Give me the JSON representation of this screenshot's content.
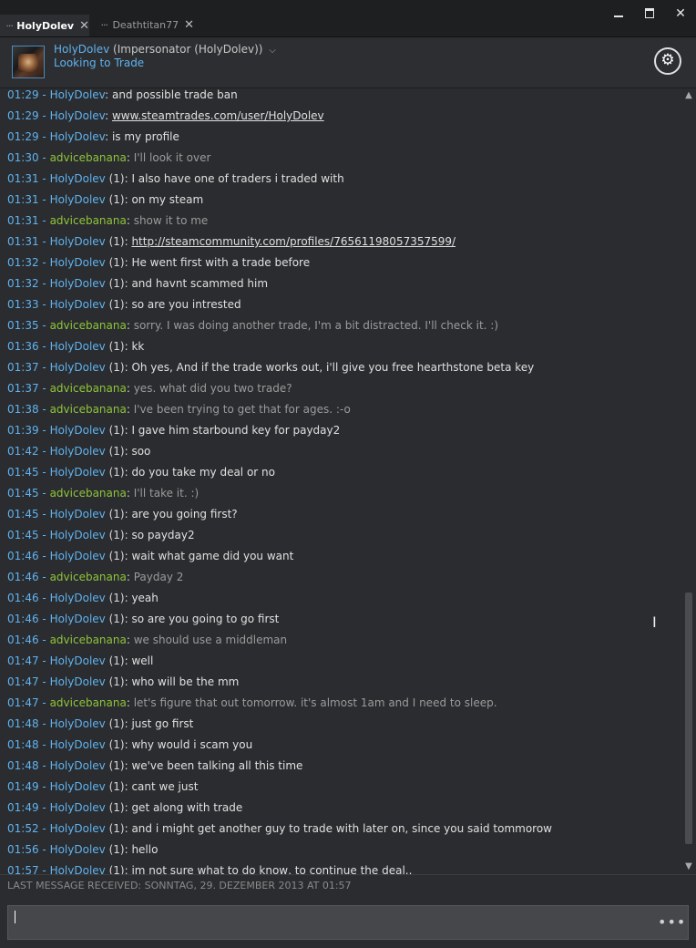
{
  "tabs": [
    {
      "label": "HolyDolev",
      "active": true
    },
    {
      "label": "Deathtitan77",
      "active": false
    }
  ],
  "window": {
    "minimize_icon": "minimize-icon",
    "maximize_icon": "maximize-icon",
    "close_icon": "close-icon"
  },
  "friend": {
    "name": "HolyDolev",
    "persona": "(Impersonator (HolyDolev))",
    "status": "Looking to Trade"
  },
  "messages": [
    {
      "ts": "01:29",
      "name": "HolyDolev",
      "tag": "",
      "text": "and possible trade ban",
      "who": "them",
      "link": false
    },
    {
      "ts": "01:29",
      "name": "HolyDolev",
      "tag": "",
      "text": "www.steamtrades.com/user/HolyDolev",
      "who": "them",
      "link": true
    },
    {
      "ts": "01:29",
      "name": "HolyDolev",
      "tag": "",
      "text": "is my profile",
      "who": "them",
      "link": false
    },
    {
      "ts": "01:30",
      "name": "advicebanana",
      "tag": "",
      "text": "I'll look it over",
      "who": "me",
      "link": false
    },
    {
      "ts": "01:31",
      "name": "HolyDolev",
      "tag": " (1)",
      "text": "I also have one of traders i traded with",
      "who": "them",
      "link": false
    },
    {
      "ts": "01:31",
      "name": "HolyDolev",
      "tag": " (1)",
      "text": "on my steam",
      "who": "them",
      "link": false
    },
    {
      "ts": "01:31",
      "name": "advicebanana",
      "tag": "",
      "text": "show it to me",
      "who": "me",
      "link": false
    },
    {
      "ts": "01:31",
      "name": "HolyDolev",
      "tag": " (1)",
      "text": "http://steamcommunity.com/profiles/76561198057357599/",
      "who": "them",
      "link": true
    },
    {
      "ts": "01:32",
      "name": "HolyDolev",
      "tag": " (1)",
      "text": "He went first with a trade before",
      "who": "them",
      "link": false
    },
    {
      "ts": "01:32",
      "name": "HolyDolev",
      "tag": " (1)",
      "text": "and havnt scammed him",
      "who": "them",
      "link": false
    },
    {
      "ts": "01:33",
      "name": "HolyDolev",
      "tag": " (1)",
      "text": "so are you intrested",
      "who": "them",
      "link": false
    },
    {
      "ts": "01:35",
      "name": "advicebanana",
      "tag": "",
      "text": "sorry. I was doing another trade, I'm a bit distracted. I'll check it. :)",
      "who": "me",
      "link": false
    },
    {
      "ts": "01:36",
      "name": "HolyDolev",
      "tag": " (1)",
      "text": "kk",
      "who": "them",
      "link": false
    },
    {
      "ts": "01:37",
      "name": "HolyDolev",
      "tag": " (1)",
      "text": "Oh yes, And if the trade works out, i'll give you free hearthstone beta key",
      "who": "them",
      "link": false
    },
    {
      "ts": "01:37",
      "name": "advicebanana",
      "tag": "",
      "text": "yes. what did you two trade?",
      "who": "me",
      "link": false
    },
    {
      "ts": "01:38",
      "name": "advicebanana",
      "tag": "",
      "text": "I've been trying to get that for ages. :-o",
      "who": "me",
      "link": false
    },
    {
      "ts": "01:39",
      "name": "HolyDolev",
      "tag": " (1)",
      "text": "I gave him starbound key for payday2",
      "who": "them",
      "link": false
    },
    {
      "ts": "01:42",
      "name": "HolyDolev",
      "tag": " (1)",
      "text": "soo",
      "who": "them",
      "link": false
    },
    {
      "ts": "01:45",
      "name": "HolyDolev",
      "tag": " (1)",
      "text": "do you take my deal or no",
      "who": "them",
      "link": false
    },
    {
      "ts": "01:45",
      "name": "advicebanana",
      "tag": "",
      "text": "I'll take it. :)",
      "who": "me",
      "link": false
    },
    {
      "ts": "01:45",
      "name": "HolyDolev",
      "tag": " (1)",
      "text": "are you going first?",
      "who": "them",
      "link": false
    },
    {
      "ts": "01:45",
      "name": "HolyDolev",
      "tag": " (1)",
      "text": "so payday2",
      "who": "them",
      "link": false
    },
    {
      "ts": "01:46",
      "name": "HolyDolev",
      "tag": " (1)",
      "text": "wait what game did you want",
      "who": "them",
      "link": false
    },
    {
      "ts": "01:46",
      "name": "advicebanana",
      "tag": "",
      "text": "Payday 2",
      "who": "me",
      "link": false
    },
    {
      "ts": "01:46",
      "name": "HolyDolev",
      "tag": " (1)",
      "text": "yeah",
      "who": "them",
      "link": false
    },
    {
      "ts": "01:46",
      "name": "HolyDolev",
      "tag": " (1)",
      "text": "so are you going to go first",
      "who": "them",
      "link": false
    },
    {
      "ts": "01:46",
      "name": "advicebanana",
      "tag": "",
      "text": "we should use a middleman",
      "who": "me",
      "link": false
    },
    {
      "ts": "01:47",
      "name": "HolyDolev",
      "tag": " (1)",
      "text": "well",
      "who": "them",
      "link": false
    },
    {
      "ts": "01:47",
      "name": "HolyDolev",
      "tag": " (1)",
      "text": "who will be the mm",
      "who": "them",
      "link": false
    },
    {
      "ts": "01:47",
      "name": "advicebanana",
      "tag": "",
      "text": "let's figure that out tomorrow. it's almost 1am and I need to sleep.",
      "who": "me",
      "link": false
    },
    {
      "ts": "01:48",
      "name": "HolyDolev",
      "tag": " (1)",
      "text": "just go first",
      "who": "them",
      "link": false
    },
    {
      "ts": "01:48",
      "name": "HolyDolev",
      "tag": " (1)",
      "text": "why would i scam you",
      "who": "them",
      "link": false
    },
    {
      "ts": "01:48",
      "name": "HolyDolev",
      "tag": " (1)",
      "text": "we've been talking all this time",
      "who": "them",
      "link": false
    },
    {
      "ts": "01:49",
      "name": "HolyDolev",
      "tag": " (1)",
      "text": "cant we just",
      "who": "them",
      "link": false
    },
    {
      "ts": "01:49",
      "name": "HolyDolev",
      "tag": " (1)",
      "text": "get along with trade",
      "who": "them",
      "link": false
    },
    {
      "ts": "01:52",
      "name": "HolyDolev",
      "tag": " (1)",
      "text": "and i might get another guy to trade with later on, since you said tommorow",
      "who": "them",
      "link": false
    },
    {
      "ts": "01:56",
      "name": "HolyDolev",
      "tag": " (1)",
      "text": "hello",
      "who": "them",
      "link": false
    },
    {
      "ts": "01:57",
      "name": "HolyDolev",
      "tag": " (1)",
      "text": "im not sure what to do know, to continue the deal..",
      "who": "them",
      "link": false
    }
  ],
  "footer": {
    "last_message": "LAST MESSAGE RECEIVED: SONNTAG, 29. DEZEMBER 2013 AT 01:57",
    "input_value": "",
    "more_icon": "more-options-icon"
  }
}
